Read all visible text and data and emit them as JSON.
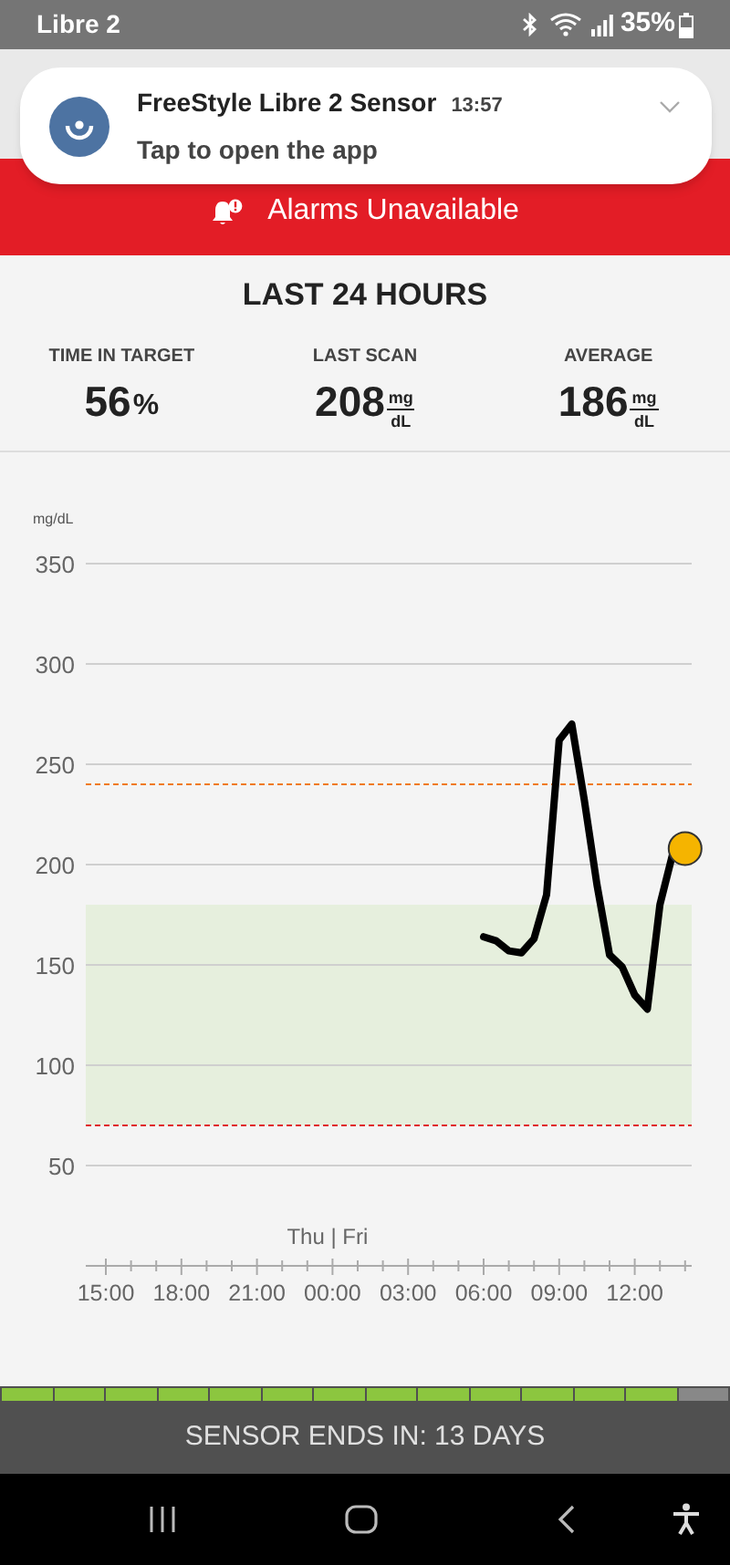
{
  "status_bar": {
    "app_name": "Libre 2",
    "battery": "35%"
  },
  "notification": {
    "title": "FreeStyle Libre 2 Sensor",
    "time": "13:57",
    "body": "Tap to open the app"
  },
  "alarm_banner": {
    "text": "Alarms Unavailable"
  },
  "summary": {
    "title": "LAST 24 HOURS",
    "stats": [
      {
        "kind": "percent",
        "label": "TIME IN TARGET",
        "value": "56",
        "unit": "%"
      },
      {
        "kind": "fraction",
        "label": "LAST SCAN",
        "value": "208",
        "unit_top": "mg",
        "unit_bottom": "dL"
      },
      {
        "kind": "fraction",
        "label": "AVERAGE",
        "value": "186",
        "unit_top": "mg",
        "unit_bottom": "dL"
      }
    ]
  },
  "chart": {
    "chart_data": {
      "type": "line",
      "ylabel": "mg/dL",
      "grid": true,
      "ylim": [
        0,
        350
      ],
      "yticks": [
        50,
        100,
        150,
        200,
        250,
        300,
        350
      ],
      "categories": [
        "15:00",
        null,
        null,
        null,
        null,
        null,
        "18:00",
        null,
        null,
        null,
        null,
        null,
        "21:00",
        null,
        null,
        null,
        null,
        null,
        "00:00",
        null,
        null,
        null,
        null,
        null,
        "03:00",
        null,
        null,
        null,
        null,
        null,
        "06:00",
        null,
        null,
        null,
        null,
        null,
        "09:00",
        null,
        null,
        null,
        null,
        null,
        "12:00",
        null,
        null,
        null,
        null
      ],
      "series": [
        {
          "color": "#000000",
          "values": [
            null,
            null,
            null,
            null,
            null,
            null,
            null,
            null,
            null,
            null,
            null,
            null,
            null,
            null,
            null,
            null,
            null,
            null,
            null,
            null,
            null,
            null,
            null,
            null,
            null,
            null,
            null,
            null,
            null,
            null,
            164,
            162,
            157,
            156,
            163,
            185,
            262,
            270,
            232,
            190,
            155,
            149,
            135,
            128,
            180,
            205,
            208
          ]
        }
      ],
      "bands": [
        {
          "axis": "y",
          "from": 70,
          "to": 180,
          "color": "#e6efdd"
        }
      ],
      "ref_lines": [
        {
          "axis": "y",
          "value": 240,
          "color": "#f07a1a"
        },
        {
          "axis": "y",
          "value": 70,
          "color": "#e0242a"
        }
      ],
      "annotations": [
        "Thu | Fri"
      ]
    }
  },
  "sensor": {
    "segments": [
      {
        "filled": true
      },
      {
        "filled": true
      },
      {
        "filled": true
      },
      {
        "filled": true
      },
      {
        "filled": true
      },
      {
        "filled": true
      },
      {
        "filled": true
      },
      {
        "filled": true
      },
      {
        "filled": true
      },
      {
        "filled": true
      },
      {
        "filled": true
      },
      {
        "filled": true
      },
      {
        "filled": true
      },
      {
        "filled": false
      }
    ],
    "text": "SENSOR ENDS IN: 13 DAYS"
  }
}
